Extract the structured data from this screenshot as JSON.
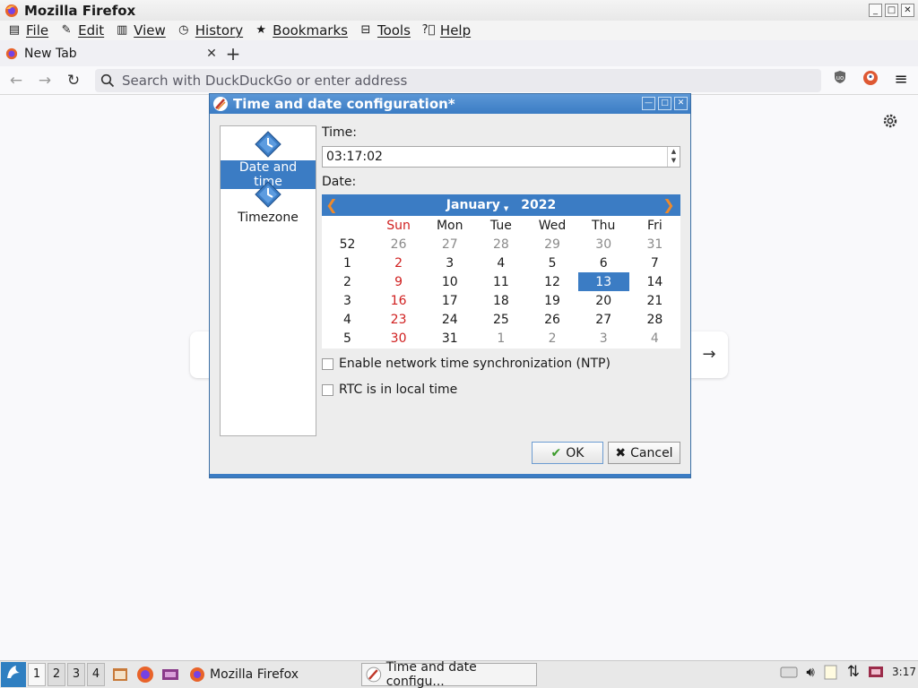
{
  "window": {
    "title": "Mozilla Firefox"
  },
  "menubar": {
    "items": [
      {
        "label": "File"
      },
      {
        "label": "Edit"
      },
      {
        "label": "View"
      },
      {
        "label": "History"
      },
      {
        "label": "Bookmarks"
      },
      {
        "label": "Tools"
      },
      {
        "label": "Help"
      }
    ]
  },
  "tabs": [
    {
      "title": "New Tab"
    }
  ],
  "urlbar": {
    "placeholder": "Search with DuckDuckGo or enter address"
  },
  "dialog": {
    "title": "Time and date configuration*",
    "sidebar": [
      {
        "label": "Date and time",
        "selected": true
      },
      {
        "label": "Timezone",
        "selected": false
      }
    ],
    "time_label": "Time:",
    "time_value": "03:17:02",
    "date_label": "Date:",
    "calendar": {
      "month": "January",
      "year": "2022",
      "weekdays": [
        "Sun",
        "Mon",
        "Tue",
        "Wed",
        "Thu",
        "Fri"
      ],
      "rows": [
        {
          "week": "52",
          "days": [
            "26",
            "27",
            "28",
            "29",
            "30",
            "31"
          ]
        },
        {
          "week": "1",
          "days": [
            "2",
            "3",
            "4",
            "5",
            "6",
            "7"
          ]
        },
        {
          "week": "2",
          "days": [
            "9",
            "10",
            "11",
            "12",
            "13",
            "14"
          ]
        },
        {
          "week": "3",
          "days": [
            "16",
            "17",
            "18",
            "19",
            "20",
            "21"
          ]
        },
        {
          "week": "4",
          "days": [
            "23",
            "24",
            "25",
            "26",
            "27",
            "28"
          ]
        },
        {
          "week": "5",
          "days": [
            "30",
            "31",
            "1",
            "2",
            "3",
            "4"
          ]
        }
      ],
      "selected_day": "13"
    },
    "ntp_label": "Enable network time synchronization (NTP)",
    "ntp_checked": false,
    "rtc_label": "RTC is in local time",
    "rtc_checked": false,
    "ok_label": "OK",
    "cancel_label": "Cancel"
  },
  "taskbar": {
    "workspaces": [
      "1",
      "2",
      "3",
      "4"
    ],
    "tasks": [
      {
        "label": "Mozilla Firefox"
      },
      {
        "label": "Time and date configu..."
      }
    ],
    "clock": "3:17"
  },
  "colors": {
    "accent": "#3b7cc4",
    "sunday": "#d01f1f",
    "arrow": "#f08a2a"
  }
}
